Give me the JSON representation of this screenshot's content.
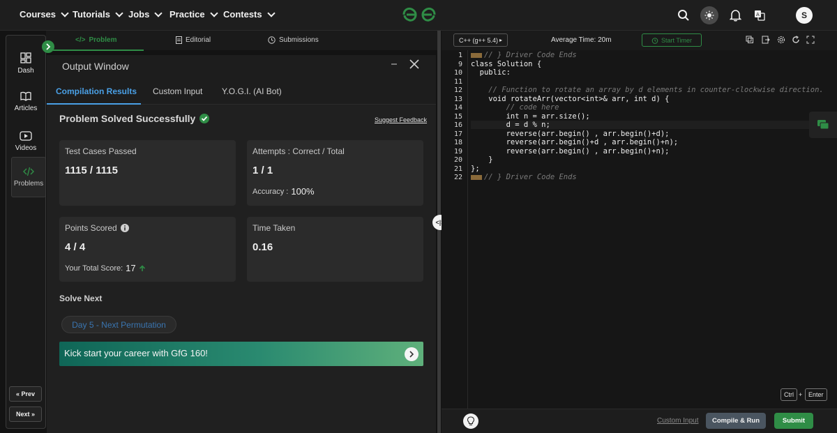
{
  "nav": {
    "items": [
      {
        "label": "Courses"
      },
      {
        "label": "Tutorials"
      },
      {
        "label": "Jobs"
      },
      {
        "label": "Practice"
      },
      {
        "label": "Contests"
      }
    ],
    "avatar_letter": "S"
  },
  "sidebar": {
    "items": [
      {
        "label": "Dash",
        "icon": "dashboard-icon"
      },
      {
        "label": "Articles",
        "icon": "book-icon"
      },
      {
        "label": "Videos",
        "icon": "video-icon"
      },
      {
        "label": "Problems",
        "icon": "code-icon"
      }
    ],
    "prev_label": "Prev",
    "next_label": "Next"
  },
  "problem_tabs": {
    "problem": "Problem",
    "editorial": "Editorial",
    "submissions": "Submissions"
  },
  "output_window": {
    "title": "Output Window",
    "tabs": [
      "Compilation Results",
      "Custom Input",
      "Y.O.G.I. (AI Bot)"
    ],
    "status": "Problem Solved Successfully",
    "suggest_feedback": "Suggest Feedback",
    "cards": {
      "test_cases": {
        "label": "Test Cases Passed",
        "value": "1115 / 1115"
      },
      "attempts": {
        "label": "Attempts : Correct / Total",
        "value": "1 / 1",
        "sub_label": "Accuracy :",
        "sub_value": "100%"
      },
      "points": {
        "label": "Points Scored",
        "value": "4 / 4",
        "sub_label": "Your Total Score:",
        "sub_value": "17"
      },
      "time": {
        "label": "Time Taken",
        "value": "0.16"
      }
    },
    "solve_next_label": "Solve Next",
    "next_problem": "Day 5 - Next Permutation",
    "banner_text": "Kick start your career with GfG 160!"
  },
  "editor_toolbar": {
    "language": "C++ (g++ 5.4)",
    "average_time": "Average Time: 20m",
    "start_timer": "Start Timer"
  },
  "code": {
    "line_numbers": [
      "1",
      "9",
      "10",
      "11",
      "12",
      "13",
      "14",
      "15",
      "16",
      "17",
      "18",
      "19",
      "20",
      "21",
      "22"
    ],
    "lines": [
      "// } Driver Code Ends",
      "class Solution {",
      "  public:",
      "",
      "    // Function to rotate an array by d elements in counter-clockwise direction.",
      "    void rotateArr(vector<int>& arr, int d) {",
      "        // code here",
      "        int n = arr.size();",
      "        d = d % n;",
      "        reverse(arr.begin() , arr.begin()+d);",
      "        reverse(arr.begin()+d , arr.begin()+n);",
      "        reverse(arr.begin() , arr.begin()+n);",
      "    }",
      "};",
      "// } Driver Code Ends"
    ]
  },
  "shortcut": {
    "key1": "Ctrl",
    "plus": "+",
    "key2": "Enter"
  },
  "bottom_bar": {
    "custom_input": "Custom Input",
    "compile_run": "Compile & Run",
    "submit": "Submit"
  },
  "colors": {
    "accent_green": "#2f8d46",
    "accent_blue": "#4aa0e6",
    "background": "#131313"
  }
}
